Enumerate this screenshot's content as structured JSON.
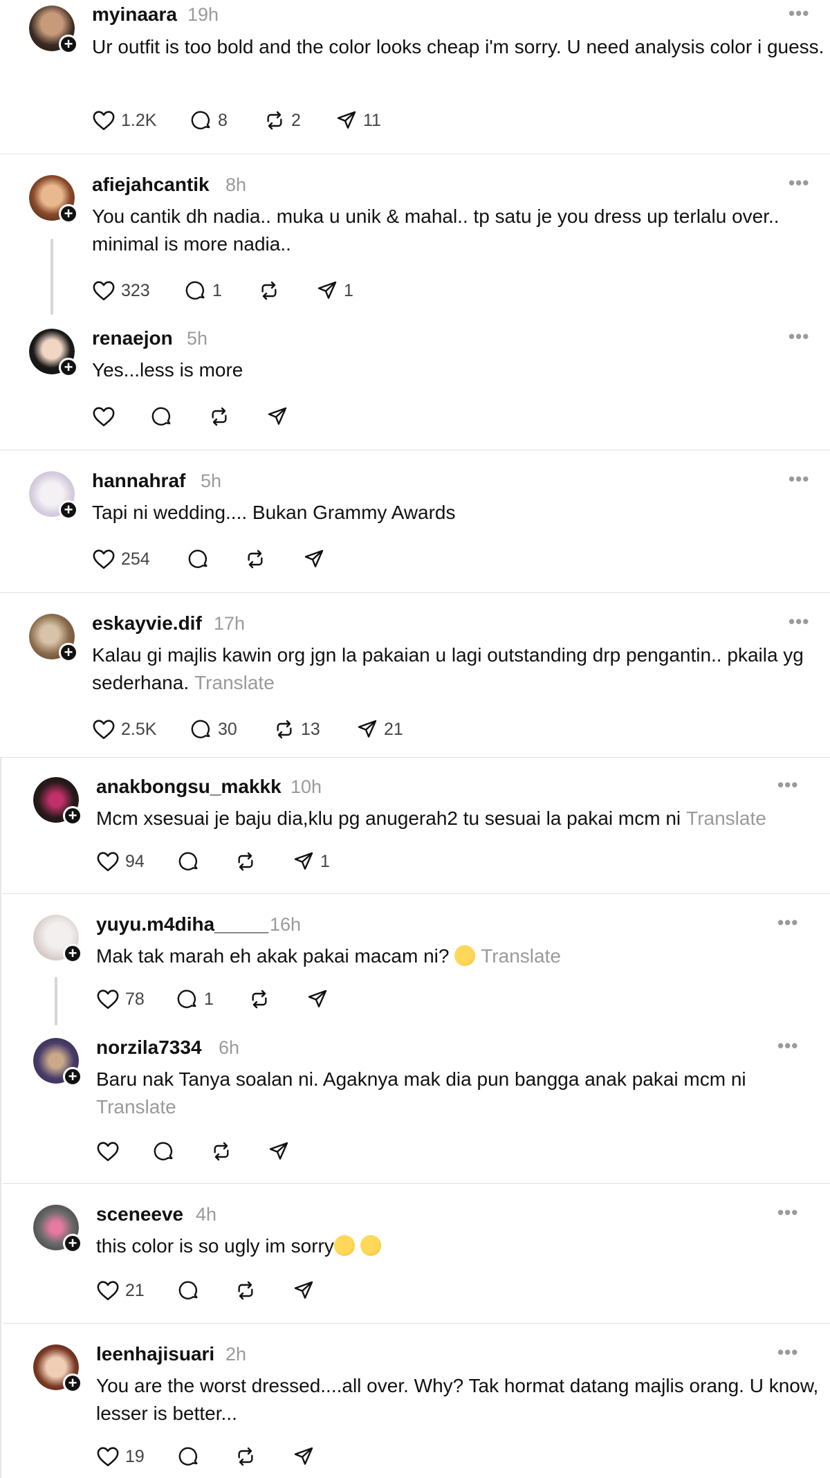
{
  "posts": [
    {
      "username": "myinaara",
      "time": "19h",
      "text": "Ur outfit is too bold and the color looks cheap i'm sorry. U need analysis color i guess.",
      "likes": "1.2K",
      "replies": "8",
      "reposts": "2",
      "shares": "11"
    },
    {
      "username": "afiejahcantik",
      "time": "8h",
      "text": "You cantik dh nadia.. muka u unik & mahal.. tp satu je you dress up terlalu over.. minimal is more nadia..",
      "likes": "323",
      "replies": "1",
      "reposts": "",
      "shares": "1"
    },
    {
      "username": "renaejon",
      "time": "5h",
      "text": "Yes...less is more",
      "likes": "",
      "replies": "",
      "reposts": "",
      "shares": ""
    },
    {
      "username": "hannahraf",
      "time": "5h",
      "text": "Tapi ni wedding.... Bukan Grammy Awards",
      "likes": "254",
      "replies": "",
      "reposts": "",
      "shares": ""
    },
    {
      "username": "eskayvie.dif",
      "time": "17h",
      "text": "Kalau gi majlis kawin org jgn la pakaian u lagi outstanding drp pengantin.. pkaila yg sederhana.",
      "translate": "Translate",
      "likes": "2.5K",
      "replies": "30",
      "reposts": "13",
      "shares": "21"
    },
    {
      "username": "anakbongsu_makkk",
      "time": "10h",
      "text": "Mcm xsesuai je baju dia,klu pg anugerah2 tu sesuai la pakai mcm ni",
      "translate": "Translate",
      "likes": "94",
      "replies": "",
      "reposts": "",
      "shares": "1"
    },
    {
      "username": "yuyu.m4diha_____",
      "time": "16h",
      "text": "Mak tak marah eh akak pakai macam ni?",
      "translate": "Translate",
      "likes": "78",
      "replies": "1",
      "reposts": "",
      "shares": ""
    },
    {
      "username": "norzila7334",
      "time": "6h",
      "text": "Baru nak Tanya soalan ni. Agaknya mak dia pun bangga anak pakai mcm ni",
      "translate": "Translate",
      "likes": "",
      "replies": "",
      "reposts": "",
      "shares": ""
    },
    {
      "username": "sceneeve",
      "time": "4h",
      "text": "this color is so ugly im sorry",
      "likes": "21",
      "replies": "",
      "reposts": "",
      "shares": ""
    },
    {
      "username": "leenhajisuari",
      "time": "2h",
      "text": "You are the worst dressed....all over. Why? Tak hormat datang majlis orang. U know, lesser is better...",
      "likes": "19",
      "replies": "",
      "reposts": "",
      "shares": ""
    }
  ],
  "icons": {
    "like": "heart-icon",
    "reply": "comment-icon",
    "repost": "repost-icon",
    "share": "share-icon",
    "more": "more-icon",
    "follow": "plus-icon"
  },
  "colors": {
    "text": "#111111",
    "muted": "#9a9a9a",
    "divider": "#e2e2e2"
  }
}
